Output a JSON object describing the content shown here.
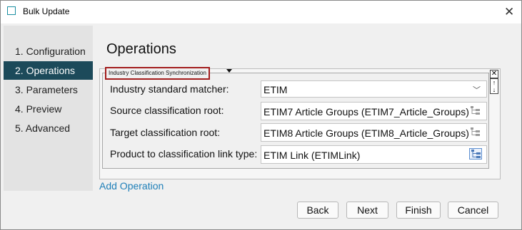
{
  "window": {
    "title": "Bulk Update",
    "close_glyph": "✕"
  },
  "sidebar": {
    "items": [
      {
        "label": "1. Configuration"
      },
      {
        "label": "2. Operations",
        "active": true
      },
      {
        "label": "3. Parameters"
      },
      {
        "label": "4. Preview"
      },
      {
        "label": "5. Advanced"
      }
    ]
  },
  "main": {
    "title": "Operations",
    "operation": {
      "group_label": "Industry Classification Synchronization",
      "rows": [
        {
          "label": "Industry standard matcher:",
          "value": "ETIM",
          "control": "dropdown"
        },
        {
          "label": "Source classification root:",
          "value": "ETIM7 Article Groups (ETIM7_Article_Groups)",
          "control": "tree-picker"
        },
        {
          "label": "Target classification root:",
          "value": "ETIM8 Article Groups (ETIM8_Article_Groups)",
          "control": "tree-picker"
        },
        {
          "label": "Product to classification link type:",
          "value": "ETIM Link (ETIMLink)",
          "control": "tree-picker"
        }
      ]
    },
    "add_operation_label": "Add Operation"
  },
  "footer": {
    "buttons": [
      "Back",
      "Next",
      "Finish",
      "Cancel"
    ]
  },
  "colors": {
    "active_nav": "#1c4a5a",
    "link": "#1e7fb8",
    "highlight_border": "#a31d1d"
  }
}
